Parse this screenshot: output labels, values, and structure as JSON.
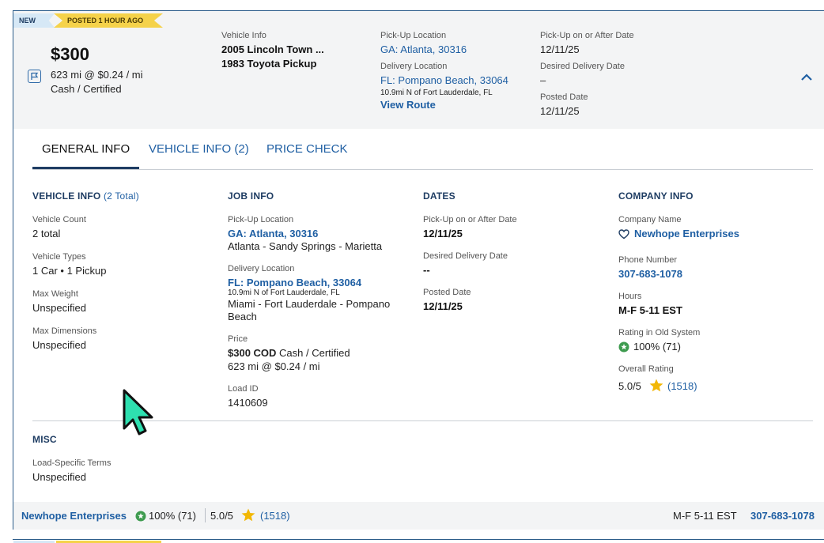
{
  "badges": {
    "new": "NEW",
    "posted": "POSTED 1 HOUR AGO"
  },
  "summary": {
    "price": "$300",
    "rate": "623 mi @ $0.24 / mi",
    "payment": "Cash / Certified",
    "vehicle_info_label": "Vehicle Info",
    "vehicle_1": "2005 Lincoln Town ...",
    "vehicle_2": "1983 Toyota Pickup",
    "pickup_label": "Pick-Up Location",
    "pickup_value": "GA: Atlanta, 30316",
    "delivery_label": "Delivery Location",
    "delivery_value": "FL: Pompano Beach, 33064",
    "delivery_note": "10.9mi N of Fort Lauderdale, FL",
    "view_route": "View Route",
    "pickup_date_label": "Pick-Up on or After Date",
    "pickup_date": "12/11/25",
    "desired_label": "Desired Delivery Date",
    "desired_value": "–",
    "posted_label": "Posted Date",
    "posted_value": "12/11/25"
  },
  "tabs": [
    {
      "label": "GENERAL INFO"
    },
    {
      "label": "VEHICLE INFO (2)"
    },
    {
      "label": "PRICE CHECK"
    }
  ],
  "vehicle_info": {
    "title": "VEHICLE INFO",
    "total": "(2 Total)",
    "count_label": "Vehicle Count",
    "count": "2 total",
    "types_label": "Vehicle Types",
    "types": "1 Car • 1 Pickup",
    "weight_label": "Max Weight",
    "weight": "Unspecified",
    "dims_label": "Max Dimensions",
    "dims": "Unspecified"
  },
  "job_info": {
    "title": "JOB INFO",
    "pickup_label": "Pick-Up Location",
    "pickup_value": "GA: Atlanta, 30316",
    "pickup_area": "Atlanta - Sandy Springs - Marietta",
    "delivery_label": "Delivery Location",
    "delivery_value": "FL: Pompano Beach, 33064",
    "delivery_note": "10.9mi N of Fort Lauderdale, FL",
    "delivery_area_1": "Miami - Fort Lauderdale - Pompano",
    "delivery_area_2": "Beach",
    "price_label": "Price",
    "price_cod": "$300 COD",
    "price_method": " Cash / Certified",
    "price_rate": "623 mi @ $0.24 / mi",
    "load_label": "Load ID",
    "load_id": "1410609"
  },
  "dates": {
    "title": "DATES",
    "pickup_label": "Pick-Up on or After Date",
    "pickup": "12/11/25",
    "desired_label": "Desired Delivery Date",
    "desired": "--",
    "posted_label": "Posted Date",
    "posted": "12/11/25"
  },
  "company_info": {
    "title": "COMPANY INFO",
    "name_label": "Company Name",
    "name": "Newhope Enterprises",
    "phone_label": "Phone Number",
    "phone": "307-683-1078",
    "hours_label": "Hours",
    "hours": "M-F 5-11 EST",
    "old_rating_label": "Rating in Old System",
    "old_rating": "100% (71)",
    "overall_label": "Overall Rating",
    "overall": "5.0/5",
    "overall_count": "(1518)"
  },
  "misc": {
    "title": "MISC",
    "terms_label": "Load-Specific Terms",
    "terms": "Unspecified"
  },
  "footer": {
    "company": "Newhope Enterprises",
    "old_rating": "100% (71)",
    "overall": "5.0/5",
    "count": "(1518)",
    "hours": "M-F 5-11 EST",
    "phone": "307-683-1078"
  },
  "colors": {
    "accent": "#1f5fa3",
    "navy": "#1f3d63",
    "star": "#f2b705",
    "ok": "#3e9b4f",
    "new_badge": "#d6e8f6",
    "posted_badge": "#f5d24a"
  }
}
